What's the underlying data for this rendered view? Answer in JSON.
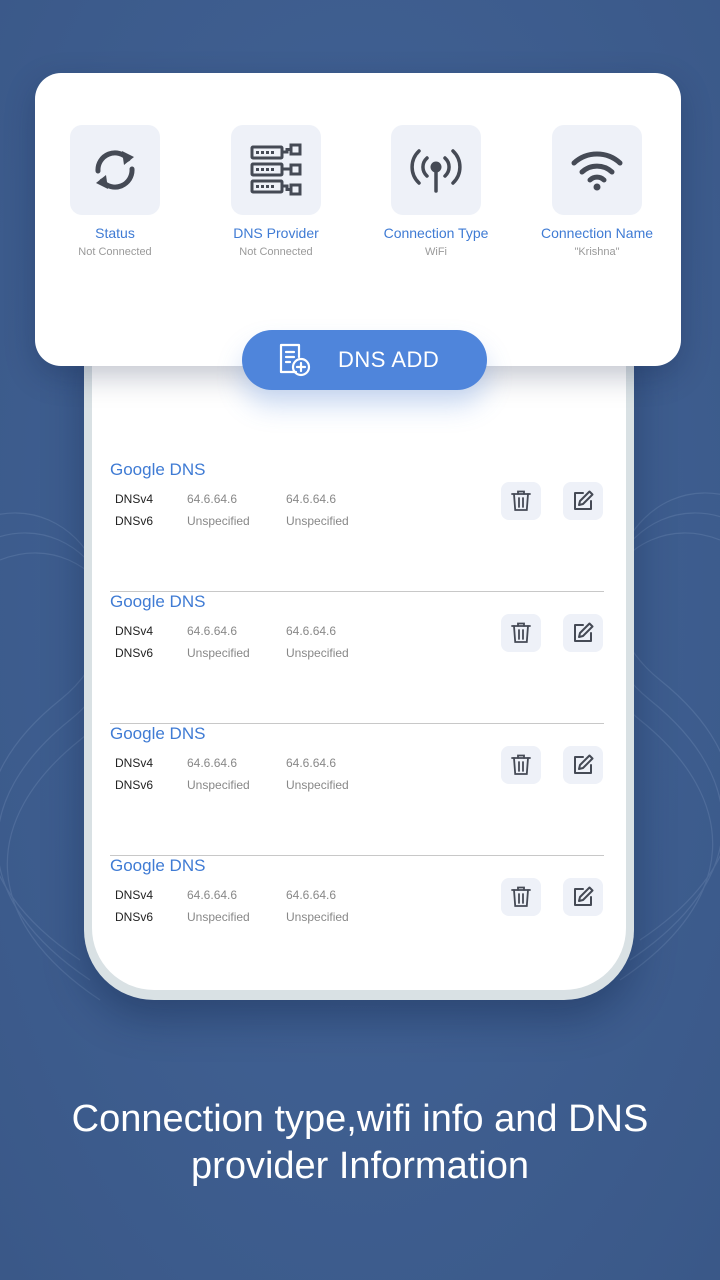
{
  "colors": {
    "background": "#3f5f91",
    "accent": "#4f85db",
    "link": "#3f7bd4",
    "icon_dark": "#454a55"
  },
  "info": [
    {
      "title": "Status",
      "sub": "Not Connected",
      "icon": "refresh-icon"
    },
    {
      "title": "DNS Provider",
      "sub": "Not Connected",
      "icon": "server-icon"
    },
    {
      "title": "Connection Type",
      "sub": "WiFi",
      "icon": "antenna-icon"
    },
    {
      "title": "Connection Name",
      "sub": "\"Krishna\"",
      "icon": "wifi-icon"
    }
  ],
  "add_button": {
    "label": "DNS ADD",
    "icon": "add-file-icon"
  },
  "dns_entries": [
    {
      "name": "Google DNS",
      "v4_label": "DNSv4",
      "v6_label": "DNSv6",
      "v4_primary": "64.6.64.6",
      "v4_secondary": "64.6.64.6",
      "v6_primary": "Unspecified",
      "v6_secondary": "Unspecified"
    },
    {
      "name": "Google DNS",
      "v4_label": "DNSv4",
      "v6_label": "DNSv6",
      "v4_primary": "64.6.64.6",
      "v4_secondary": "64.6.64.6",
      "v6_primary": "Unspecified",
      "v6_secondary": "Unspecified"
    },
    {
      "name": "Google DNS",
      "v4_label": "DNSv4",
      "v6_label": "DNSv6",
      "v4_primary": "64.6.64.6",
      "v4_secondary": "64.6.64.6",
      "v6_primary": "Unspecified",
      "v6_secondary": "Unspecified"
    },
    {
      "name": "Google DNS",
      "v4_label": "DNSv4",
      "v6_label": "DNSv6",
      "v4_primary": "64.6.64.6",
      "v4_secondary": "64.6.64.6",
      "v6_primary": "Unspecified",
      "v6_secondary": "Unspecified"
    }
  ],
  "caption": "Connection type,wifi info and DNS provider Information"
}
